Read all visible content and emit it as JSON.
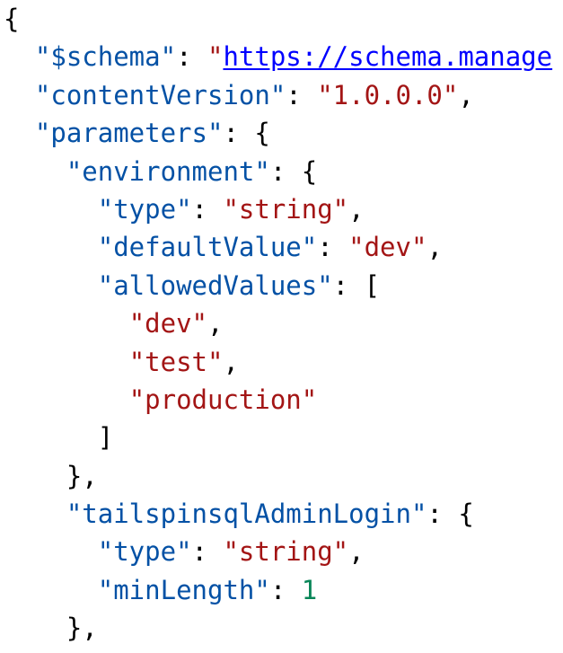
{
  "document": {
    "lines": [
      {
        "indent": "",
        "tokens": [
          {
            "t": "p",
            "v": "{"
          }
        ]
      },
      {
        "indent": "  ",
        "tokens": [
          {
            "t": "k",
            "v": "\"$schema\""
          },
          {
            "t": "p",
            "v": ": "
          },
          {
            "t": "s",
            "v": "\""
          },
          {
            "t": "u",
            "v": "https://schema.manage"
          }
        ]
      },
      {
        "indent": "  ",
        "tokens": [
          {
            "t": "k",
            "v": "\"contentVersion\""
          },
          {
            "t": "p",
            "v": ": "
          },
          {
            "t": "s",
            "v": "\"1.0.0.0\""
          },
          {
            "t": "p",
            "v": ","
          }
        ]
      },
      {
        "indent": "  ",
        "tokens": [
          {
            "t": "k",
            "v": "\"parameters\""
          },
          {
            "t": "p",
            "v": ": {"
          }
        ]
      },
      {
        "indent": "    ",
        "tokens": [
          {
            "t": "k",
            "v": "\"environment\""
          },
          {
            "t": "p",
            "v": ": {"
          }
        ]
      },
      {
        "indent": "      ",
        "tokens": [
          {
            "t": "k",
            "v": "\"type\""
          },
          {
            "t": "p",
            "v": ": "
          },
          {
            "t": "s",
            "v": "\"string\""
          },
          {
            "t": "p",
            "v": ","
          }
        ]
      },
      {
        "indent": "      ",
        "tokens": [
          {
            "t": "k",
            "v": "\"defaultValue\""
          },
          {
            "t": "p",
            "v": ": "
          },
          {
            "t": "s",
            "v": "\"dev\""
          },
          {
            "t": "p",
            "v": ","
          }
        ]
      },
      {
        "indent": "      ",
        "tokens": [
          {
            "t": "k",
            "v": "\"allowedValues\""
          },
          {
            "t": "p",
            "v": ": ["
          }
        ]
      },
      {
        "indent": "        ",
        "tokens": [
          {
            "t": "s",
            "v": "\"dev\""
          },
          {
            "t": "p",
            "v": ","
          }
        ]
      },
      {
        "indent": "        ",
        "tokens": [
          {
            "t": "s",
            "v": "\"test\""
          },
          {
            "t": "p",
            "v": ","
          }
        ]
      },
      {
        "indent": "        ",
        "tokens": [
          {
            "t": "s",
            "v": "\"production\""
          }
        ]
      },
      {
        "indent": "      ",
        "tokens": [
          {
            "t": "p",
            "v": "]"
          }
        ]
      },
      {
        "indent": "    ",
        "tokens": [
          {
            "t": "p",
            "v": "},"
          }
        ]
      },
      {
        "indent": "    ",
        "tokens": [
          {
            "t": "k",
            "v": "\"tailspinsqlAdminLogin\""
          },
          {
            "t": "p",
            "v": ": {"
          }
        ]
      },
      {
        "indent": "      ",
        "tokens": [
          {
            "t": "k",
            "v": "\"type\""
          },
          {
            "t": "p",
            "v": ": "
          },
          {
            "t": "s",
            "v": "\"string\""
          },
          {
            "t": "p",
            "v": ","
          }
        ]
      },
      {
        "indent": "      ",
        "tokens": [
          {
            "t": "k",
            "v": "\"minLength\""
          },
          {
            "t": "p",
            "v": ": "
          },
          {
            "t": "n",
            "v": "1"
          }
        ]
      },
      {
        "indent": "    ",
        "tokens": [
          {
            "t": "p",
            "v": "},"
          }
        ]
      }
    ]
  },
  "colors": {
    "key": "#0451a5",
    "string": "#a31515",
    "link": "#0000ff",
    "punctuation": "#000000",
    "background": "#ffffff"
  }
}
